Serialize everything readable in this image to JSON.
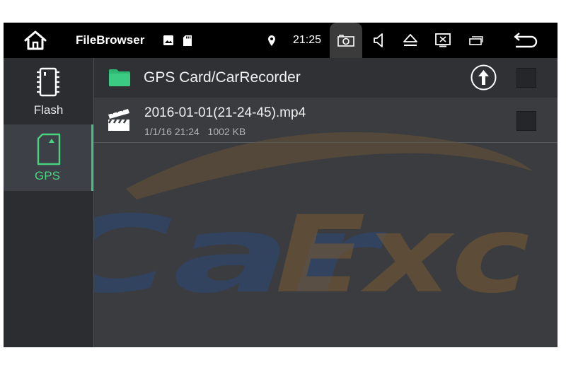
{
  "statusbar": {
    "app_title": "FileBrowser",
    "time": "21:25",
    "icons": [
      "home-icon",
      "image-icon",
      "sd-card-icon",
      "location-pin-icon",
      "camera-icon",
      "volume-icon",
      "eject-icon",
      "screen-off-icon",
      "recent-apps-icon",
      "back-icon"
    ]
  },
  "sidebar": {
    "items": [
      {
        "label": "Flash",
        "icon": "chip-icon",
        "selected": false
      },
      {
        "label": "GPS",
        "icon": "sd-card-icon",
        "selected": true
      }
    ]
  },
  "main": {
    "path": "GPS Card/CarRecorder",
    "files": [
      {
        "name": "2016-01-01(21-24-45).mp4",
        "date": "1/1/16 21:24",
        "size": "1002 KB",
        "icon": "video-clapper-icon"
      }
    ]
  },
  "watermark": {
    "text": "CarExc"
  },
  "colors": {
    "accent": "#48d47f",
    "statusbar_bg": "#000000",
    "content_bg": "#3a3c40"
  }
}
